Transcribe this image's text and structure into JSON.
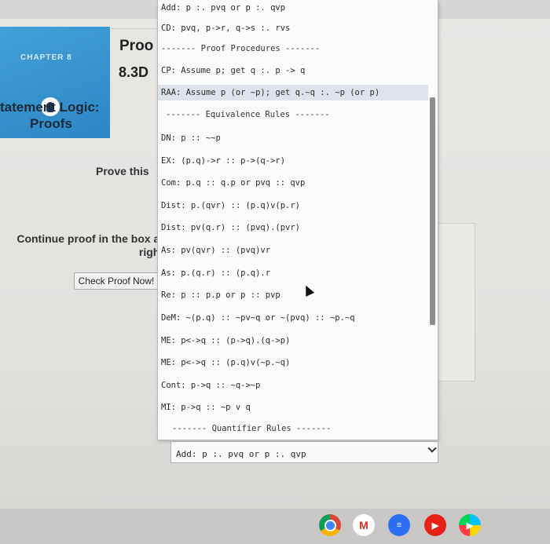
{
  "book": {
    "chapter_label": "CHAPTER 8",
    "proof_word": "Proo",
    "section_number": "8.3D",
    "title_line1": "tatement Logic:",
    "title_line2": "Proofs"
  },
  "main": {
    "prove_this": "Prove this",
    "continue_line1": "Continue proof in the box at",
    "continue_line2": "right",
    "check_button": "Check Proof Now!"
  },
  "dropdown": {
    "selected_index": 4,
    "options": [
      "Add: p :. pvq or p :. qvp",
      "CD: pvq, p->r, q->s :. rvs",
      "------- Proof Procedures -------",
      "CP: Assume p; get q :. p -> q",
      "RAA: Assume p (or ~p); get q.~q :. ~p (or p)",
      "------- Equivalence Rules -------",
      "DN: p :: ~~p",
      "EX: (p.q)->r :: p->(q->r)",
      "Com: p.q :: q.p or pvq :: qvp",
      "Dist: p.(qvr) :: (p.q)v(p.r)",
      "Dist: pv(q.r) :: (pvq).(pvr)",
      "As: pv(qvr) :: (pvq)vr",
      "As: p.(q.r) :: (p.q).r",
      "Re: p :: p.p or p :: pvp",
      "DeM: ~(p.q) :: ~pv~q or ~(pvq) :: ~p.~q",
      "ME: p<->q :: (p->q).(q->p)",
      "ME: p<->q :: (p.q)v(~p.~q)",
      "Cont: p->q :: ~q->~p",
      "MI: p->q :: ~p v q",
      "------- Quantifier Rules -------"
    ],
    "current_value": "Add: p :. pvq or p :. qvp"
  },
  "shelf": {
    "icons": [
      "chrome-icon",
      "gmail-icon",
      "docs-icon",
      "youtube-icon",
      "play-store-icon"
    ],
    "gmail_glyph": "M"
  }
}
